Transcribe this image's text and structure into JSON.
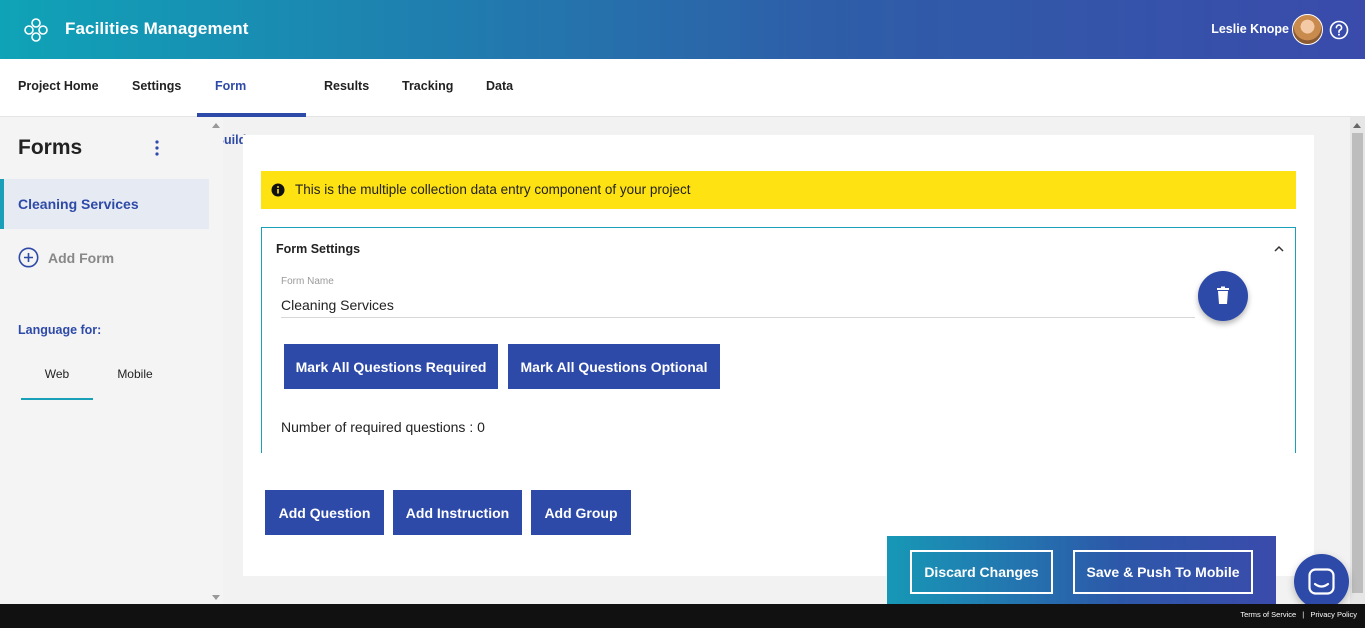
{
  "header": {
    "app_title": "Facilities Management",
    "user_name": "Leslie Knope"
  },
  "nav": {
    "tabs": [
      {
        "label": "Project Home"
      },
      {
        "label": "Settings"
      },
      {
        "label": "Form Builder",
        "active": true
      },
      {
        "label": "Results"
      },
      {
        "label": "Tracking"
      },
      {
        "label": "Data"
      }
    ]
  },
  "sidebar": {
    "title": "Forms",
    "active_form": "Cleaning Services",
    "add_form_label": "Add Form",
    "language_label": "Language for:",
    "language_tabs": [
      "Web",
      "Mobile"
    ]
  },
  "notice": {
    "text": "This is the multiple collection data entry component of your project"
  },
  "form_settings": {
    "title": "Form Settings",
    "form_name_label": "Form Name",
    "form_name_value": "Cleaning Services",
    "mark_required_label": "Mark All Questions Required",
    "mark_optional_label": "Mark All Questions Optional",
    "required_count_text": "Number of required questions : 0"
  },
  "builder_actions": {
    "add_question": "Add Question",
    "add_instruction": "Add Instruction",
    "add_group": "Add Group"
  },
  "action_bar": {
    "discard_label": "Discard Changes",
    "save_label": "Save & Push To Mobile"
  },
  "footer": {
    "terms": "Terms of Service",
    "privacy": "Privacy Policy"
  },
  "colors": {
    "primary": "#2e4aa8",
    "accent": "#19a0b8",
    "notice": "#ffe211"
  }
}
